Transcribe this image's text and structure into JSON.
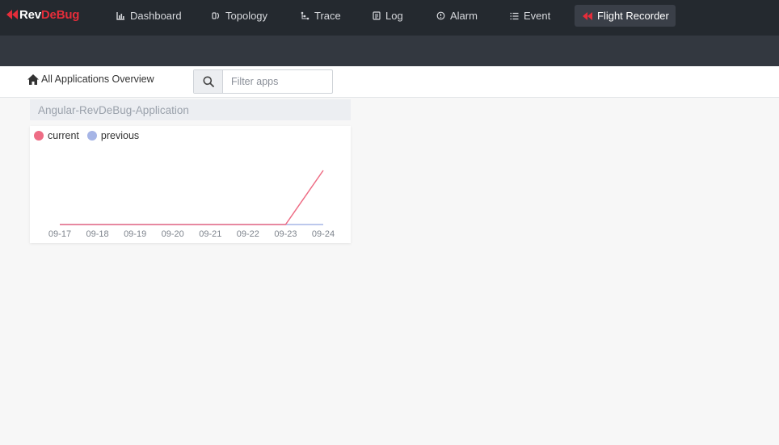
{
  "brand": {
    "rev": "Rev",
    "debug": "DeBug"
  },
  "nav": {
    "items": [
      {
        "label": "Dashboard",
        "icon": "bar-chart-icon"
      },
      {
        "label": "Topology",
        "icon": "topology-icon"
      },
      {
        "label": "Trace",
        "icon": "trace-icon"
      },
      {
        "label": "Log",
        "icon": "log-icon"
      },
      {
        "label": "Alarm",
        "icon": "alarm-icon"
      },
      {
        "label": "Event",
        "icon": "list-icon"
      },
      {
        "label": "Flight Recorder",
        "icon": "flight-recorder-icon",
        "active": true
      }
    ]
  },
  "toolbar": {
    "breadcrumb": "All Applications Overview",
    "search_placeholder": "Filter apps",
    "search_value": ""
  },
  "apps": [
    {
      "name": "Angular-RevDeBug-Application",
      "legend": {
        "current": "current",
        "previous": "previous"
      }
    }
  ],
  "colors": {
    "current": "#ee6d85",
    "previous": "#a6b5e6",
    "brand_red": "#e52d3a"
  },
  "chart_data": {
    "type": "line",
    "x": [
      "09-17",
      "09-18",
      "09-19",
      "09-20",
      "09-21",
      "09-22",
      "09-23",
      "09-24"
    ],
    "series": [
      {
        "name": "current",
        "values": [
          0,
          0,
          0,
          0,
          0,
          0,
          0,
          1
        ]
      },
      {
        "name": "previous",
        "values": [
          0,
          0,
          0,
          0,
          0,
          0,
          0,
          0
        ]
      }
    ],
    "title": "",
    "xlabel": "",
    "ylabel": "",
    "ylim": [
      0,
      1
    ],
    "grid": false,
    "legend": "top-left"
  }
}
